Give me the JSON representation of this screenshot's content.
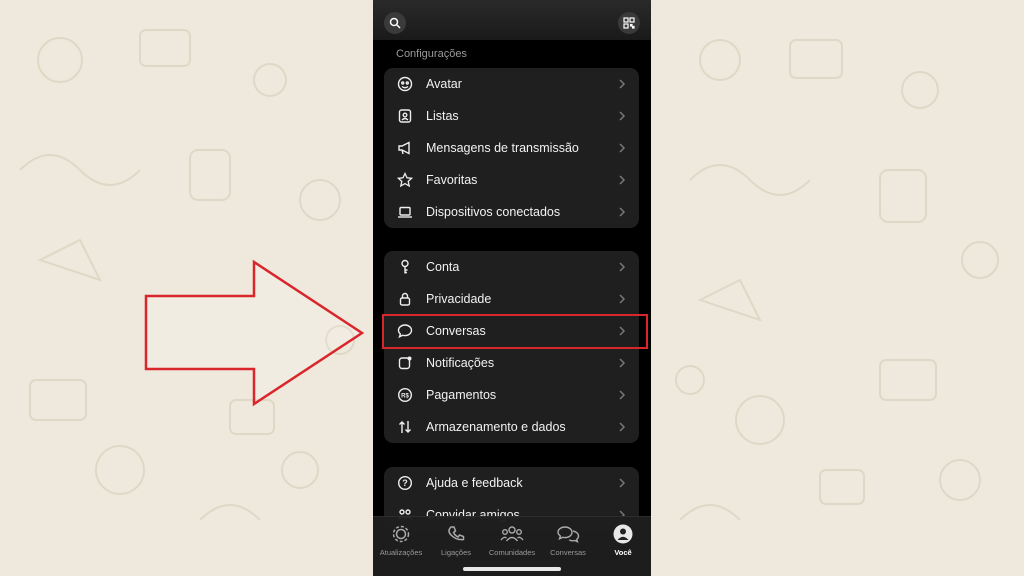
{
  "settings": {
    "section_title": "Configurações",
    "group1": [
      {
        "label": "Avatar",
        "icon": "avatar-icon"
      },
      {
        "label": "Listas",
        "icon": "list-contact-icon"
      },
      {
        "label": "Mensagens de transmissão",
        "icon": "megaphone-icon"
      },
      {
        "label": "Favoritas",
        "icon": "star-icon"
      },
      {
        "label": "Dispositivos conectados",
        "icon": "laptop-icon"
      }
    ],
    "group2": [
      {
        "label": "Conta",
        "icon": "key-icon"
      },
      {
        "label": "Privacidade",
        "icon": "lock-icon"
      },
      {
        "label": "Conversas",
        "icon": "chat-bubble-icon"
      },
      {
        "label": "Notificações",
        "icon": "notification-icon"
      },
      {
        "label": "Pagamentos",
        "icon": "payments-icon"
      },
      {
        "label": "Armazenamento e dados",
        "icon": "storage-arrows-icon"
      }
    ],
    "group3": [
      {
        "label": "Ajuda e feedback",
        "icon": "help-icon"
      },
      {
        "label": "Convidar amigos",
        "icon": "invite-friends-icon"
      }
    ]
  },
  "tabbar": {
    "tabs": [
      {
        "label": "Atualizações",
        "icon": "updates-icon"
      },
      {
        "label": "Ligações",
        "icon": "phone-icon"
      },
      {
        "label": "Comunidades",
        "icon": "communities-icon"
      },
      {
        "label": "Conversas",
        "icon": "chats-icon"
      },
      {
        "label": "Você",
        "icon": "profile-icon"
      }
    ],
    "active": "Você"
  },
  "colors": {
    "accent_highlight": "#d9262b",
    "background": "#efe9dd",
    "panel": "#1f1f1f"
  }
}
